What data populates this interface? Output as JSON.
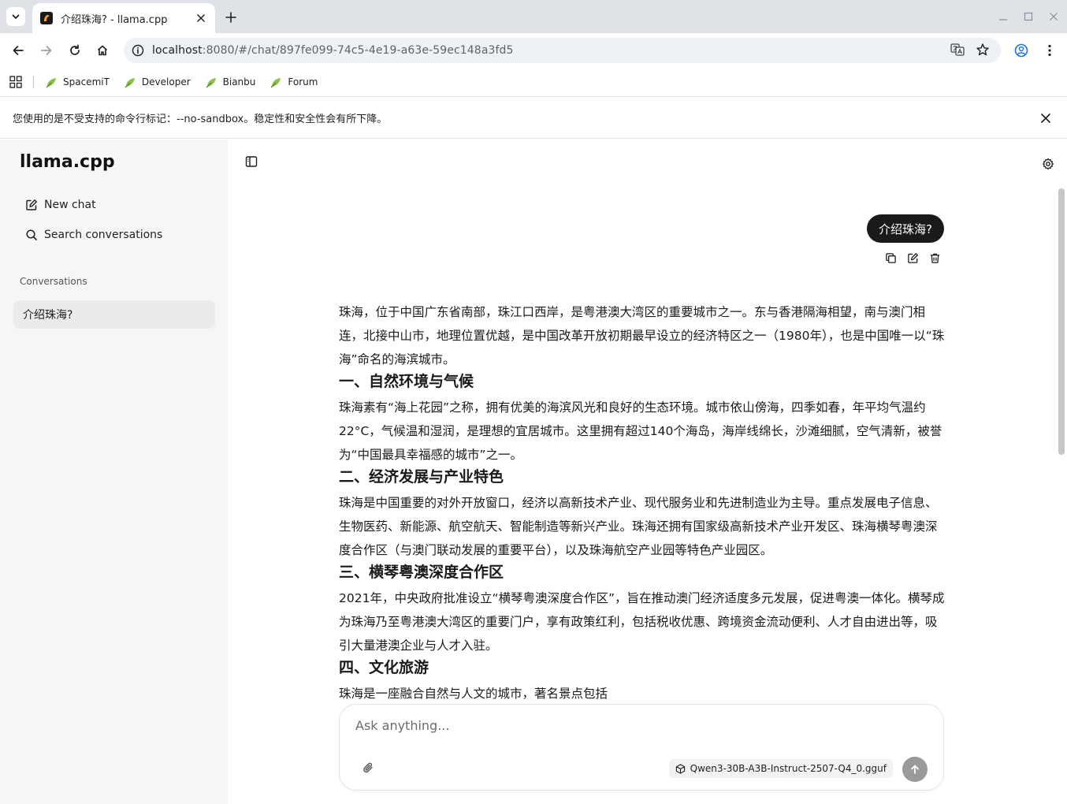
{
  "browser": {
    "tab_title": "介绍珠海? - llama.cpp",
    "url_host": "localhost",
    "url_path": ":8080/#/chat/897fe099-74c5-4e19-a63e-59ec148a3fd5",
    "bookmarks": [
      "SpacemiT",
      "Developer",
      "Bianbu",
      "Forum"
    ],
    "infobar_text": "您使用的是不受支持的命令行标记：--no-sandbox。稳定性和安全性会有所下降。"
  },
  "sidebar": {
    "brand": "llama.cpp",
    "new_chat": "New chat",
    "search": "Search conversations",
    "heading": "Conversations",
    "conversations": [
      "介绍珠海?"
    ]
  },
  "chat": {
    "user_message": "介绍珠海?",
    "answer": {
      "intro": "珠海，位于中国广东省南部，珠江口西岸，是粤港澳大湾区的重要城市之一。东与香港隔海相望，南与澳门相连，北接中山市，地理位置优越，是中国改革开放初期最早设立的经济特区之一（1980年），也是中国唯一以“珠海”命名的海滨城市。",
      "sections": [
        {
          "heading": "一、自然环境与气候",
          "body": "珠海素有“海上花园”之称，拥有优美的海滨风光和良好的生态环境。城市依山傍海，四季如春，年平均气温约22°C，气候温和湿润，是理想的宜居城市。这里拥有超过140个海岛，海岸线绵长，沙滩细腻，空气清新，被誉为“中国最具幸福感的城市”之一。"
        },
        {
          "heading": "二、经济发展与产业特色",
          "body": "珠海是中国重要的对外开放窗口，经济以高新技术产业、现代服务业和先进制造业为主导。重点发展电子信息、生物医药、新能源、航空航天、智能制造等新兴产业。珠海还拥有国家级高新技术产业开发区、珠海横琴粤澳深度合作区（与澳门联动发展的重要平台），以及珠海航空产业园等特色产业园区。"
        },
        {
          "heading": "三、横琴粤澳深度合作区",
          "body": "2021年，中央政府批准设立“横琴粤澳深度合作区”，旨在推动澳门经济适度多元发展，促进粤澳一体化。横琴成为珠海乃至粤港澳大湾区的重要门户，享有政策红利，包括税收优惠、跨境资金流动便利、人才自由进出等，吸引大量港澳企业与人才入驻。"
        },
        {
          "heading": "四、文化旅游",
          "body": "珠海是一座融合自然与人文的城市，著名景点包括"
        }
      ]
    }
  },
  "composer": {
    "placeholder": "Ask anything...",
    "model": "Qwen3-30B-A3B-Instruct-2507-Q4_0.gguf"
  }
}
